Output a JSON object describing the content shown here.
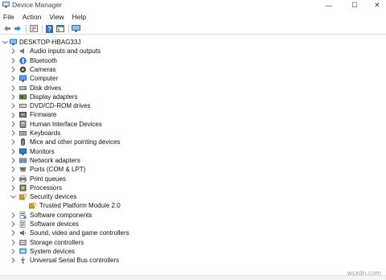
{
  "window": {
    "title": "Device Manager",
    "controls": {
      "minimize": "—",
      "maximize": "☐",
      "close": "✕"
    }
  },
  "menubar": [
    "File",
    "Action",
    "View",
    "Help"
  ],
  "toolbar": [
    "back-arrow-icon",
    "forward-arrow-icon",
    "properties-icon",
    "help-icon",
    "console-icon",
    "monitor-icon"
  ],
  "tree": {
    "root": "DESKTOP-HBAG33J",
    "categories": [
      {
        "label": "Audio inputs and outputs",
        "icon": "speaker-icon"
      },
      {
        "label": "Bluetooth",
        "icon": "bluetooth-icon"
      },
      {
        "label": "Cameras",
        "icon": "camera-icon"
      },
      {
        "label": "Computer",
        "icon": "computer-icon"
      },
      {
        "label": "Disk drives",
        "icon": "disk-drive-icon"
      },
      {
        "label": "Display adapters",
        "icon": "display-adapter-icon"
      },
      {
        "label": "DVD/CD-ROM drives",
        "icon": "dvd-icon"
      },
      {
        "label": "Firmware",
        "icon": "firmware-icon"
      },
      {
        "label": "Human Interface Devices",
        "icon": "hid-icon"
      },
      {
        "label": "Keyboards",
        "icon": "keyboard-icon"
      },
      {
        "label": "Mice and other pointing devices",
        "icon": "mouse-icon"
      },
      {
        "label": "Monitors",
        "icon": "monitor-icon"
      },
      {
        "label": "Network adapters",
        "icon": "network-icon"
      },
      {
        "label": "Ports (COM & LPT)",
        "icon": "port-icon"
      },
      {
        "label": "Print queues",
        "icon": "printer-icon"
      },
      {
        "label": "Processors",
        "icon": "processor-icon"
      },
      {
        "label": "Security devices",
        "icon": "security-icon",
        "expanded": true,
        "children": [
          "Trusted Platform Module 2.0"
        ]
      },
      {
        "label": "Software components",
        "icon": "software-component-icon"
      },
      {
        "label": "Software devices",
        "icon": "software-device-icon"
      },
      {
        "label": "Sound, video and game controllers",
        "icon": "sound-icon"
      },
      {
        "label": "Storage controllers",
        "icon": "storage-icon"
      },
      {
        "label": "System devices",
        "icon": "system-icon"
      },
      {
        "label": "Universal Serial Bus controllers",
        "icon": "usb-icon"
      }
    ]
  },
  "watermark": "wsxdn.com"
}
